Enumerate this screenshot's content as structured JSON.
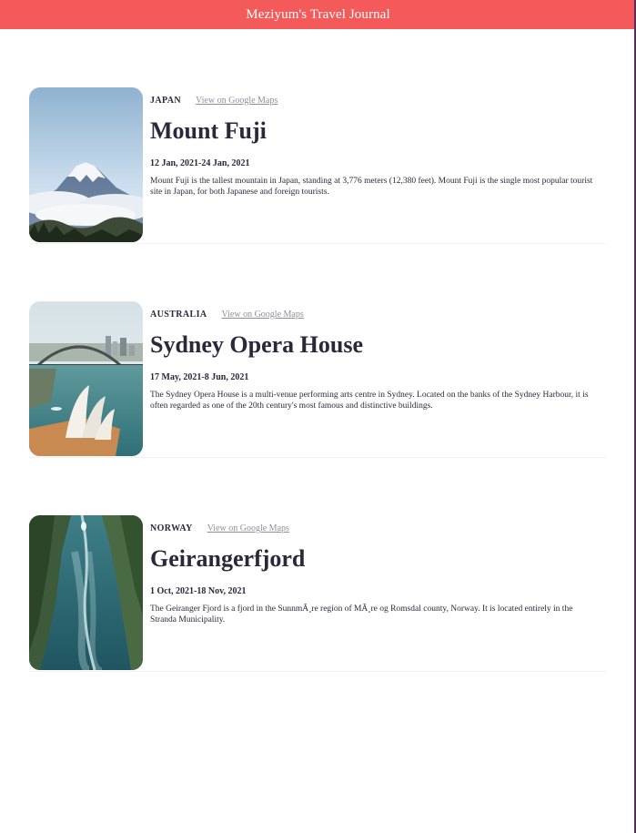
{
  "header": {
    "title": "Meziyum's Travel Journal"
  },
  "entries": [
    {
      "country": "JAPAN",
      "maps_link": "View on Google Maps",
      "title": "Mount Fuji",
      "dates": "12 Jan, 2021-24 Jan, 2021",
      "description": "Mount Fuji is the tallest mountain in Japan, standing at 3,776 meters (12,380 feet). Mount Fuji is the single most popular tourist site in Japan, for both Japanese and foreign tourists."
    },
    {
      "country": "AUSTRALIA",
      "maps_link": "View on Google Maps",
      "title": "Sydney Opera House",
      "dates": "17 May, 2021-8 Jun, 2021",
      "description": "The Sydney Opera House is a multi-venue performing arts centre in Sydney. Located on the banks of the Sydney Harbour, it is often regarded as one of the 20th century's most famous and distinctive buildings."
    },
    {
      "country": "NORWAY",
      "maps_link": "View on Google Maps",
      "title": "Geirangerfjord",
      "dates": "1 Oct, 2021-18 Nov, 2021",
      "description": "The Geiranger Fjord is a fjord in the SunnmÃ¸re region of MÃ¸re og Romsdal county, Norway. It is located entirely in the Stranda Municipality."
    }
  ],
  "colors": {
    "header_bg": "#f55a5a",
    "text": "#2b283a",
    "link": "#918e9b"
  }
}
